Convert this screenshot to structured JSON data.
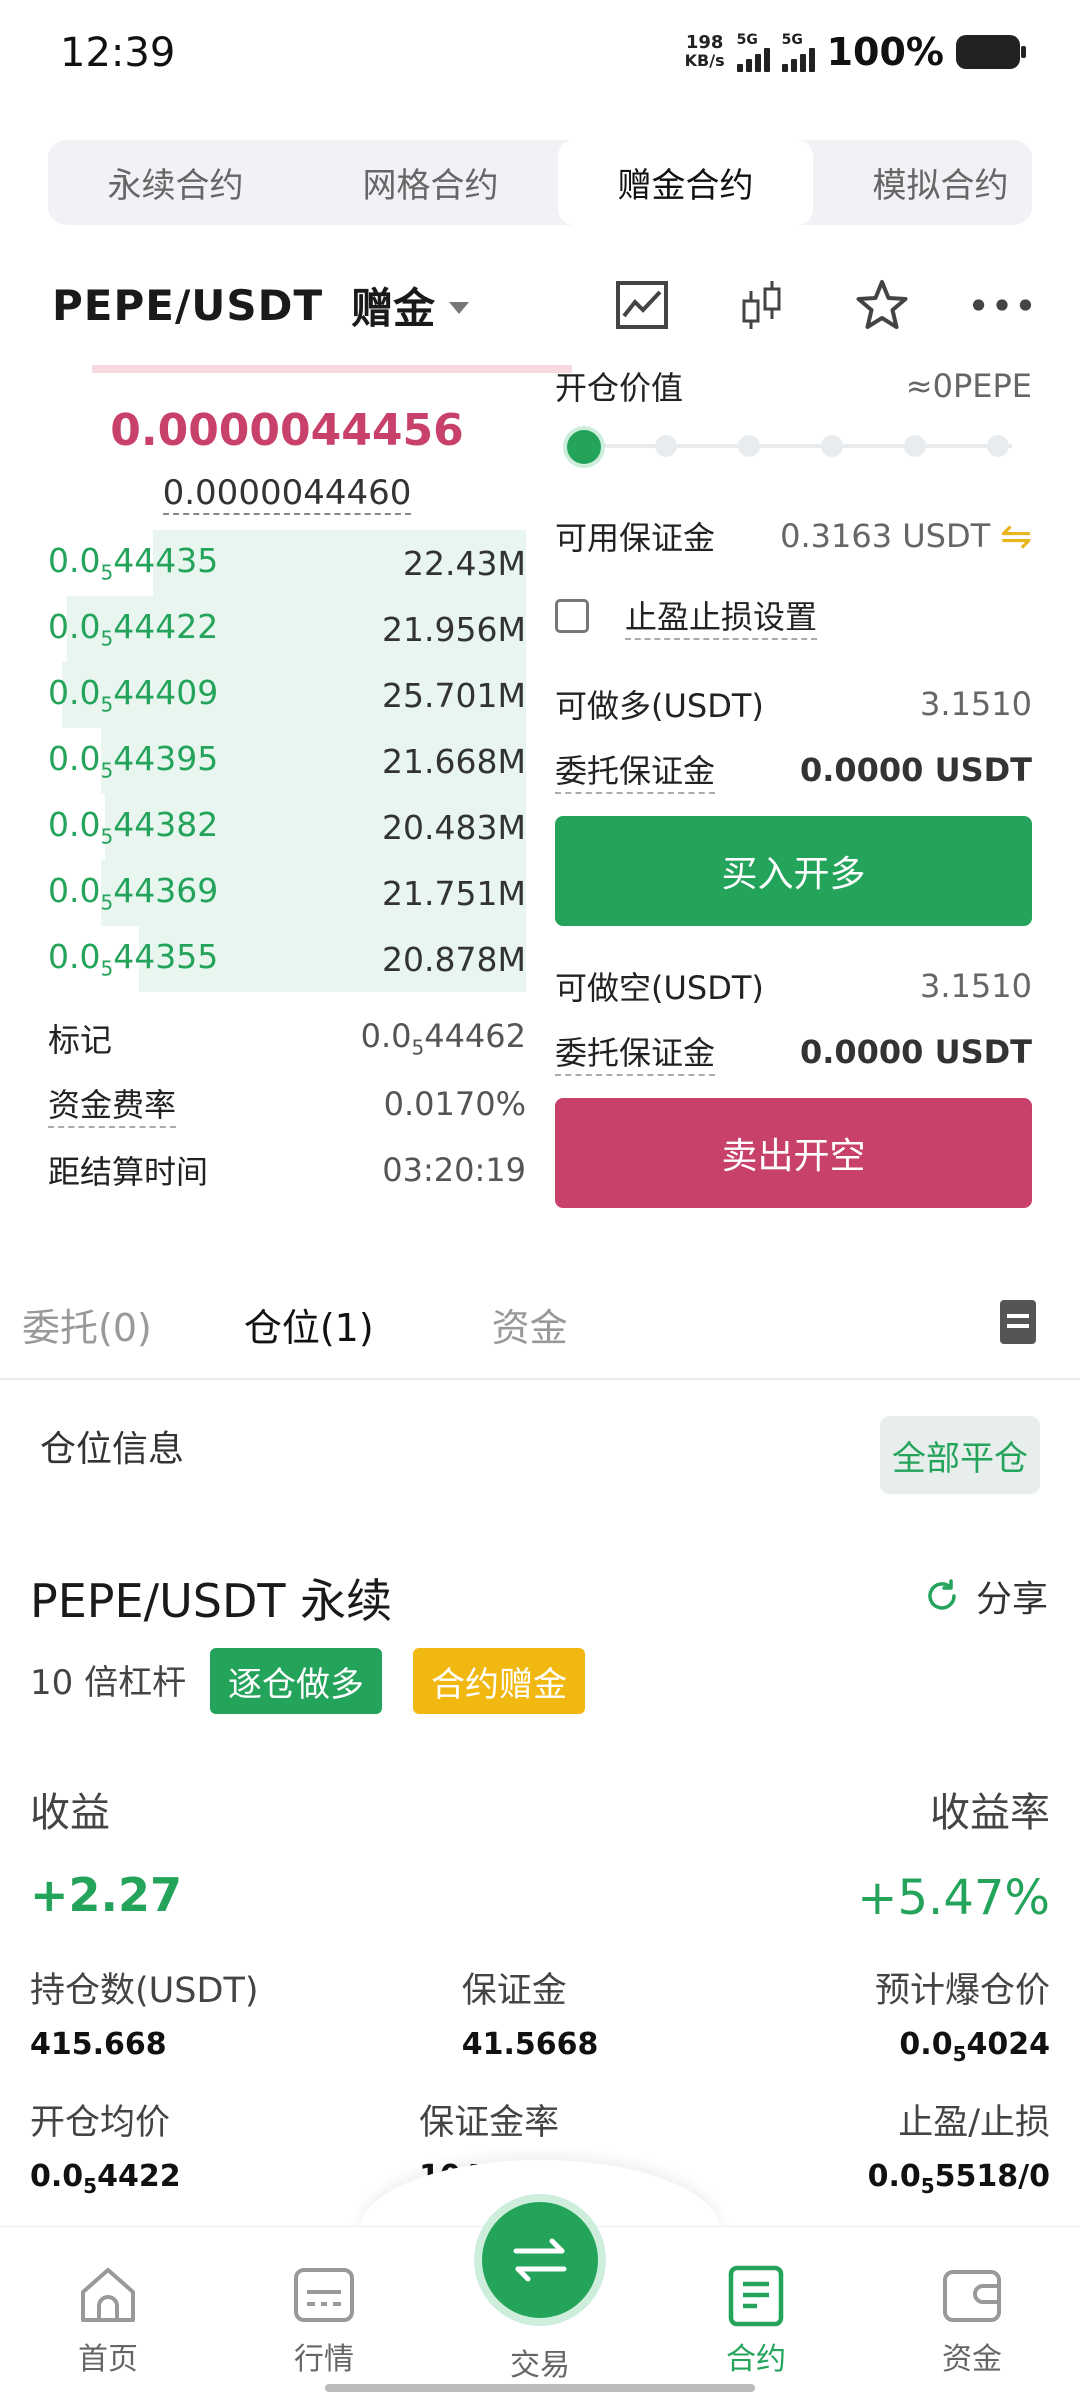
{
  "status_bar": {
    "time": "12:39",
    "net_speed_value": "198",
    "net_speed_unit": "KB/s",
    "sim1": "5G",
    "sim2": "5G",
    "battery": "100%"
  },
  "top_tabs": [
    {
      "label": "永续合约",
      "active": false
    },
    {
      "label": "网格合约",
      "active": false
    },
    {
      "label": "赠金合约",
      "active": true
    },
    {
      "label": "模拟合约",
      "active": false
    }
  ],
  "pair_header": {
    "pair": "PEPE/USDT",
    "tag": "赠金",
    "icons": [
      "chart-line-icon",
      "candlestick-icon",
      "star-icon",
      "more-icon"
    ]
  },
  "order_book": {
    "last_price": "0.0000044456",
    "mark_price": "0.0000044460",
    "rows": [
      {
        "price_prefix": "0.0",
        "price_sub": "5",
        "price_rest": "44435",
        "qty": "22.43M",
        "depth": 0.78
      },
      {
        "price_prefix": "0.0",
        "price_sub": "5",
        "price_rest": "44422",
        "qty": "21.956M",
        "depth": 0.96
      },
      {
        "price_prefix": "0.0",
        "price_sub": "5",
        "price_rest": "44409",
        "qty": "25.701M",
        "depth": 0.97
      },
      {
        "price_prefix": "0.0",
        "price_sub": "5",
        "price_rest": "44395",
        "qty": "21.668M",
        "depth": 0.89
      },
      {
        "price_prefix": "0.0",
        "price_sub": "5",
        "price_rest": "44382",
        "qty": "20.483M",
        "depth": 0.88
      },
      {
        "price_prefix": "0.0",
        "price_sub": "5",
        "price_rest": "44369",
        "qty": "21.751M",
        "depth": 0.89
      },
      {
        "price_prefix": "0.0",
        "price_sub": "5",
        "price_rest": "44355",
        "qty": "20.878M",
        "depth": 0.81
      }
    ],
    "info": {
      "mark_label": "标记",
      "mark_prefix": "0.0",
      "mark_sub": "5",
      "mark_rest": "44462",
      "funding_label": "资金费率",
      "funding_value": "0.0170%",
      "settle_label": "距结算时间",
      "settle_value": "03:20:19"
    }
  },
  "order_form": {
    "open_value_label": "开仓价值",
    "open_value": "≈0PEPE",
    "slider_value": 0,
    "avail_margin_label": "可用保证金",
    "avail_margin_value": "0.3163 USDT",
    "tpsl_label": "止盈止损设置",
    "long_avail_label": "可做多(USDT)",
    "long_avail_value": "3.1510",
    "long_margin_label": "委托保证金",
    "long_margin_value": "0.0000 USDT",
    "buy_button": "买入开多",
    "short_avail_label": "可做空(USDT)",
    "short_avail_value": "3.1510",
    "short_margin_label": "委托保证金",
    "short_margin_value": "0.0000 USDT",
    "sell_button": "卖出开空"
  },
  "position_tabs": [
    {
      "label": "委托(0)",
      "active": false
    },
    {
      "label": "仓位(1)",
      "active": true
    },
    {
      "label": "资金",
      "active": false
    }
  ],
  "position": {
    "section_title": "仓位信息",
    "close_all": "全部平仓",
    "name": "PEPE/USDT 永续",
    "share": "分享",
    "leverage": "10 倍杠杆",
    "badge_mode": "逐仓做多",
    "badge_bonus": "合约赠金",
    "pnl_label": "收益",
    "pnl_value": "+2.27",
    "roi_label": "收益率",
    "roi_value": "+5.47%",
    "size_label": "持仓数(USDT)",
    "size_value": "415.668",
    "margin_label": "保证金",
    "margin_value": "41.5668",
    "liq_label": "预计爆仓价",
    "liq_prefix": "0.0",
    "liq_sub": "5",
    "liq_rest": "4024",
    "entry_label": "开仓均价",
    "entry_prefix": "0.0",
    "entry_sub": "5",
    "entry_rest": "4422",
    "margin_ratio_label": "保证金率",
    "margin_ratio_value": "104.89%",
    "tpsl_label": "止盈/止损",
    "tpsl_prefix": "0.0",
    "tpsl_sub": "5",
    "tpsl_rest": "5518/0"
  },
  "bottom_nav": {
    "home": "首页",
    "market": "行情",
    "trade": "交易",
    "contract": "合约",
    "assets": "资金"
  },
  "colors": {
    "green": "#24a35b",
    "red": "#c8416b",
    "yellow": "#f2b812"
  }
}
